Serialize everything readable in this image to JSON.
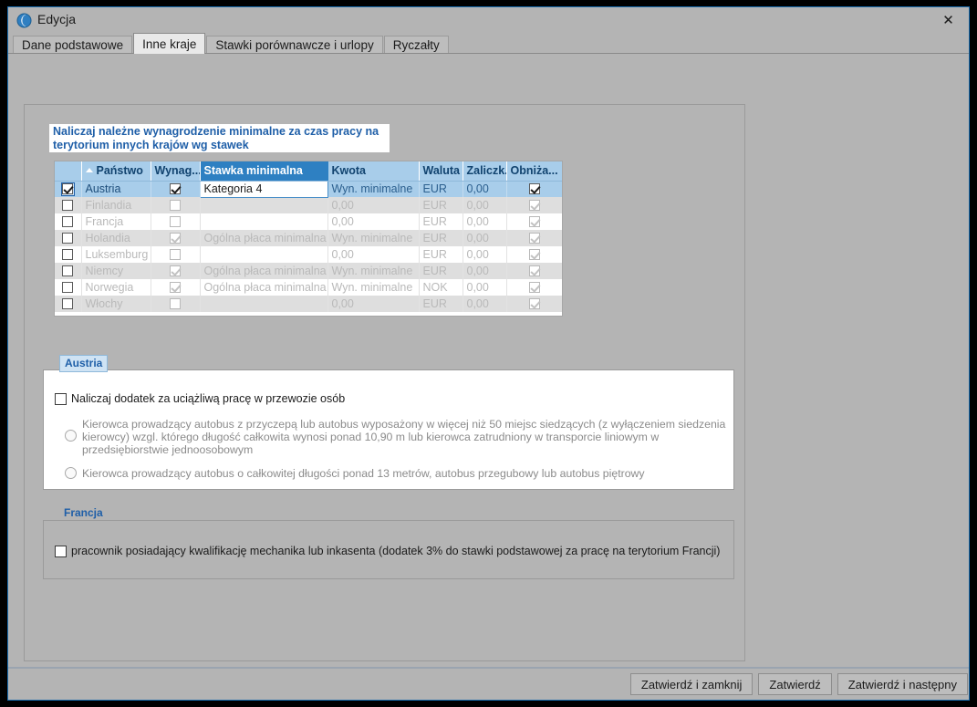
{
  "window": {
    "title": "Edycja",
    "icon": "app-icon",
    "close_label": "✕"
  },
  "tabs": [
    {
      "label": "Dane podstawowe",
      "active": false
    },
    {
      "label": "Inne kraje",
      "active": true
    },
    {
      "label": "Stawki porównawcze i urlopy",
      "active": false
    },
    {
      "label": "Ryczałty",
      "active": false
    }
  ],
  "info_label": "Naliczaj należne wynagrodzenie minimalne za czas pracy na terytorium innych krajów wg stawek",
  "grid": {
    "columns": [
      {
        "label": "",
        "key": "check"
      },
      {
        "label": "Państwo",
        "key": "country",
        "sorted": true
      },
      {
        "label": "Wynag...",
        "key": "wyn"
      },
      {
        "label": "Stawka minimalna",
        "key": "stawka",
        "selected": true
      },
      {
        "label": "Kwota",
        "key": "kwota"
      },
      {
        "label": "Waluta",
        "key": "waluta"
      },
      {
        "label": "Zaliczk...",
        "key": "zaliczka"
      },
      {
        "label": "Obniża...",
        "key": "obniza"
      }
    ],
    "rows": [
      {
        "check": true,
        "country": "Austria",
        "wyn": true,
        "stawka": "Kategoria 4",
        "kwota": "Wyn. minimalne",
        "waluta": "EUR",
        "zaliczka": "0,00",
        "obniza": true,
        "selected": true
      },
      {
        "check": false,
        "country": "Finlandia",
        "wyn": false,
        "stawka": "",
        "kwota": "0,00",
        "waluta": "EUR",
        "zaliczka": "0,00",
        "obniza": true
      },
      {
        "check": false,
        "country": "Francja",
        "wyn": false,
        "stawka": "",
        "kwota": "0,00",
        "waluta": "EUR",
        "zaliczka": "0,00",
        "obniza": true
      },
      {
        "check": false,
        "country": "Holandia",
        "wyn": true,
        "stawka": "Ogólna płaca minimalna",
        "kwota": "Wyn. minimalne",
        "waluta": "EUR",
        "zaliczka": "0,00",
        "obniza": true
      },
      {
        "check": false,
        "country": "Luksemburg",
        "wyn": false,
        "stawka": "",
        "kwota": "0,00",
        "waluta": "EUR",
        "zaliczka": "0,00",
        "obniza": true
      },
      {
        "check": false,
        "country": "Niemcy",
        "wyn": true,
        "stawka": "Ogólna płaca minimalna",
        "kwota": "Wyn. minimalne",
        "waluta": "EUR",
        "zaliczka": "0,00",
        "obniza": true
      },
      {
        "check": false,
        "country": "Norwegia",
        "wyn": true,
        "stawka": "Ogólna płaca minimalna",
        "kwota": "Wyn. minimalne",
        "waluta": "NOK",
        "zaliczka": "0,00",
        "obniza": true
      },
      {
        "check": false,
        "country": "Włochy",
        "wyn": false,
        "stawka": "",
        "kwota": "0,00",
        "waluta": "EUR",
        "zaliczka": "0,00",
        "obniza": true
      }
    ]
  },
  "austria": {
    "group_label": "Austria",
    "checkbox_label": "Naliczaj dodatek za uciążliwą pracę w przewozie osób",
    "checkbox_checked": false,
    "option1": "Kierowca prowadzący autobus z przyczepą lub autobus wyposażony w więcej niż 50 miejsc siedzących (z wyłączeniem siedzenia kierowcy) wzgl. którego długość całkowita wynosi ponad 10,90 m lub kierowca zatrudniony w transporcie liniowym w przedsiębiorstwie jednoosobowym",
    "option2": "Kierowca prowadzący autobus o całkowitej długości ponad 13 metrów, autobus przegubowy lub autobus piętrowy"
  },
  "francja": {
    "group_label": "Francja",
    "checkbox_label": "pracownik posiadający kwalifikację mechanika lub inkasenta (dodatek 3% do stawki podstawowej za pracę na terytorium Francji)",
    "checkbox_checked": false
  },
  "footer": {
    "buttons": [
      "Zatwierdź i zamknij",
      "Zatwierdź",
      "Zatwierdź i następny"
    ]
  },
  "colors": {
    "accent_blue": "#1f5fa8",
    "header_blue": "#a8cdea",
    "selected_col": "#2e80c2",
    "window_bg": "#b4b4b4"
  }
}
